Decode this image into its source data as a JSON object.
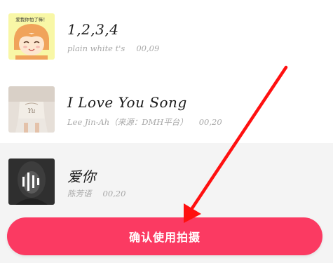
{
  "songs": [
    {
      "title": "1,2,3,4",
      "artist": "plain white t's",
      "duration": "00,09",
      "cover": "anime-girl-cover"
    },
    {
      "title": "I Love You Song",
      "artist": "Lee Jin-Ah（来源：DMH平台）",
      "duration": "00,20",
      "cover": "girl-photo-cover"
    },
    {
      "title": "爱你",
      "artist": "陈芳语",
      "duration": "00,20",
      "cover": "dark-portrait-cover"
    }
  ],
  "cover_text": {
    "speech_bubble": "爱我你怕了嘛！",
    "photo_caption": "Yu"
  },
  "confirm_button": {
    "label": "确认使用拍摄"
  },
  "colors": {
    "accent": "#fb3a62",
    "arrow": "#ff1010",
    "selected_row": "#f4f4f4"
  }
}
